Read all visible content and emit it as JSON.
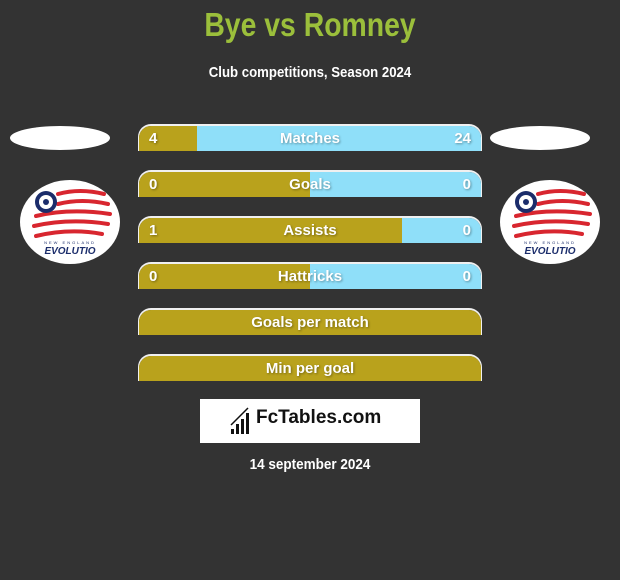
{
  "header": {
    "title": "Bye vs Romney",
    "subtitle": "Club competitions, Season 2024"
  },
  "teams": {
    "left": {
      "logo": "new-england-revolution-logo",
      "logo_text": "EVOLUTIO",
      "logo_small_text": "NEW ENGLAND"
    },
    "right": {
      "logo": "new-england-revolution-logo",
      "logo_text": "EVOLUTIO",
      "logo_small_text": "NEW ENGLAND"
    }
  },
  "colors": {
    "title": "#9bbf3b",
    "left_bar": "#b9a21c",
    "right_bar": "#8fdff9",
    "background": "#333333"
  },
  "stats": [
    {
      "label": "Matches",
      "left": "4",
      "right": "24",
      "left_fraction": 0.17
    },
    {
      "label": "Goals",
      "left": "0",
      "right": "0",
      "left_fraction": 0.5
    },
    {
      "label": "Assists",
      "left": "1",
      "right": "0",
      "left_fraction": 0.77
    },
    {
      "label": "Hattricks",
      "left": "0",
      "right": "0",
      "left_fraction": 0.5
    },
    {
      "label": "Goals per match",
      "left": "",
      "right": "",
      "left_fraction": 1.0
    },
    {
      "label": "Min per goal",
      "left": "",
      "right": "",
      "left_fraction": 1.0
    }
  ],
  "brand": {
    "name": "FcTables.com",
    "icon": "bar-chart-icon"
  },
  "footer": {
    "date": "14 september 2024"
  }
}
